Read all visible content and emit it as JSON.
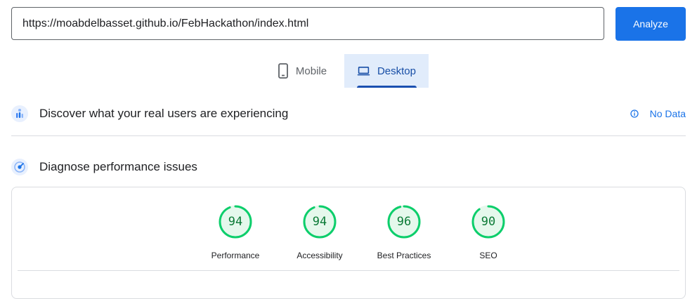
{
  "search": {
    "url_value": "https://moabdelbasset.github.io/FebHackathon/index.html",
    "analyze_label": "Analyze"
  },
  "tabs": [
    {
      "label": "Mobile",
      "icon": "phone-icon",
      "selected": false
    },
    {
      "label": "Desktop",
      "icon": "laptop-icon",
      "selected": true
    }
  ],
  "field_data": {
    "title": "Discover what your real users are experiencing",
    "status_label": "No Data",
    "status_icon": "info-icon"
  },
  "lab_data": {
    "title": "Diagnose performance issues",
    "scores": [
      {
        "label": "Performance",
        "score": "94",
        "value": 94
      },
      {
        "label": "Accessibility",
        "score": "94",
        "value": 94
      },
      {
        "label": "Best Practices",
        "score": "96",
        "value": 96
      },
      {
        "label": "SEO",
        "score": "90",
        "value": 90
      }
    ]
  },
  "colors": {
    "accent": "#1a73e8",
    "pass_green": "#0cce6b",
    "pass_text": "#0b7a36",
    "pass_track": "#e5f8ec",
    "tab_selected_bg": "#e1ecfb"
  }
}
